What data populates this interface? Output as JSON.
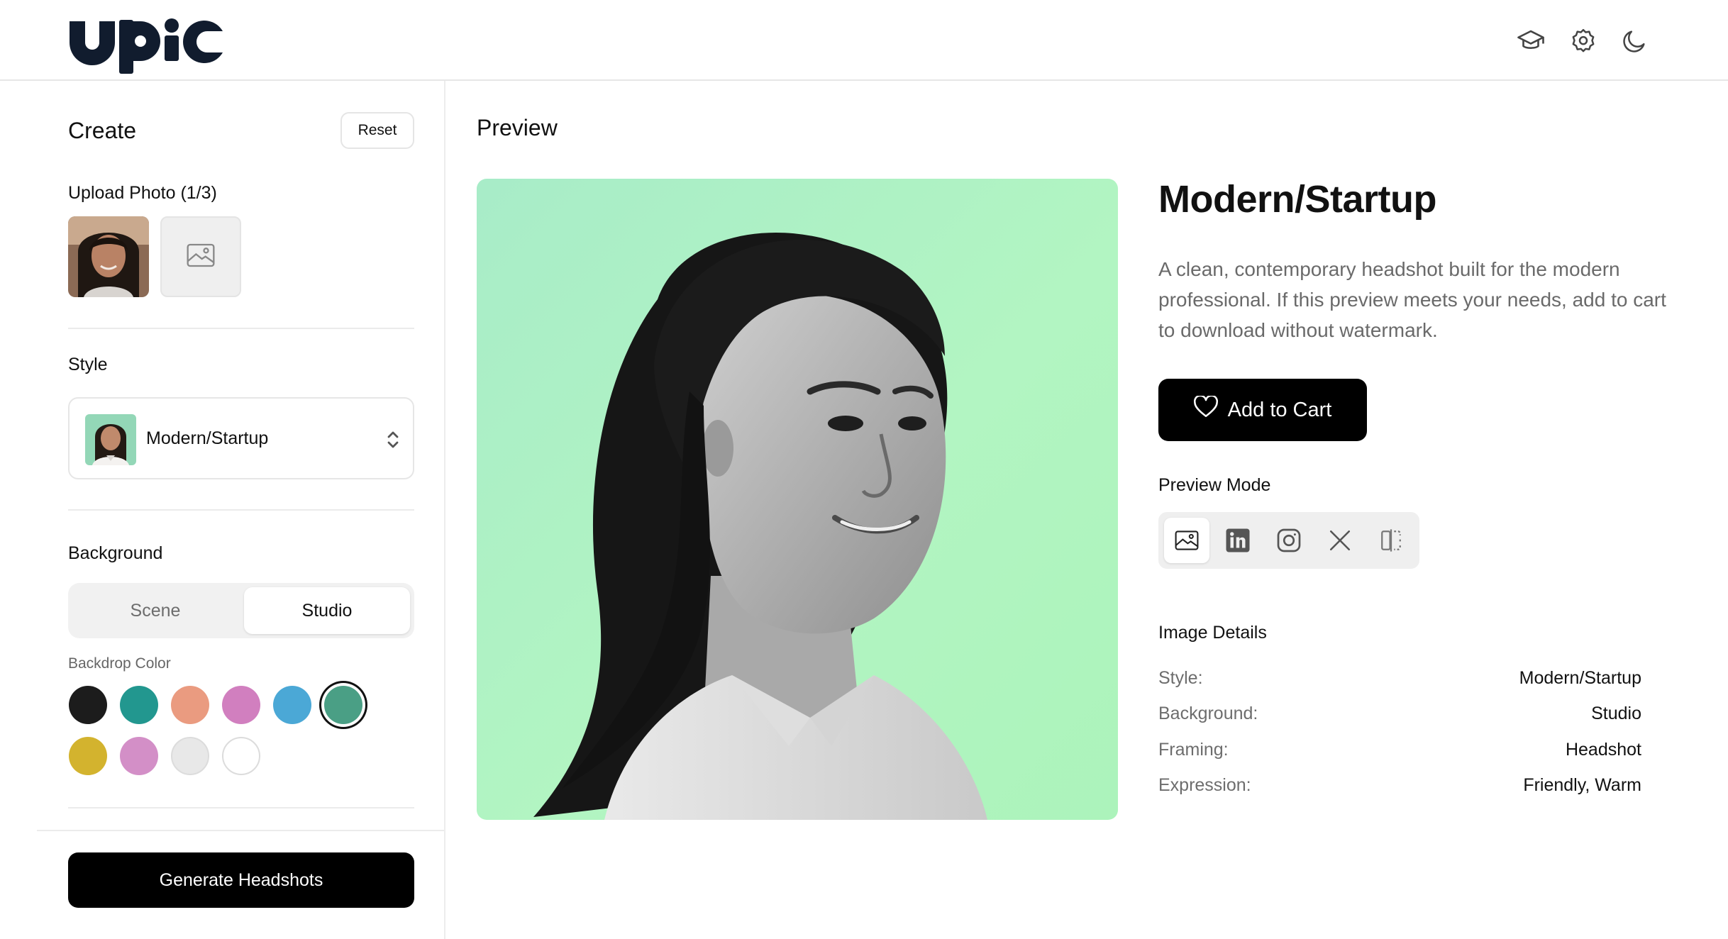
{
  "header": {
    "logo_text": "upic",
    "icons": [
      "graduation-cap-icon",
      "settings-gear-icon",
      "moon-icon"
    ]
  },
  "sidebar": {
    "title": "Create",
    "reset_label": "Reset",
    "upload": {
      "label": "Upload Photo (1/3)"
    },
    "style": {
      "label": "Style",
      "selected": "Modern/Startup"
    },
    "background": {
      "label": "Background",
      "options": [
        "Scene",
        "Studio"
      ],
      "selected": "Studio",
      "backdrop_label": "Backdrop Color",
      "colors": [
        "#1c1c1c",
        "#22978f",
        "#ea9b80",
        "#d17fbf",
        "#4ba8d6",
        "#4a9f85",
        "#d3b32e",
        "#d38fc7",
        "#e8e8e8",
        "#ffffff"
      ],
      "selected_color": "#4a9f85"
    },
    "generate_label": "Generate Headshots"
  },
  "main": {
    "preview_title": "Preview",
    "style_heading": "Modern/Startup",
    "description": "A clean, contemporary headshot built for the modern professional. If this preview meets your needs, add to cart to download without watermark.",
    "add_to_cart_label": "Add to Cart",
    "preview_mode": {
      "label": "Preview Mode",
      "modes": [
        "image-icon",
        "linkedin-icon",
        "instagram-icon",
        "x-icon",
        "compare-icon"
      ],
      "active": "image-icon"
    },
    "details": {
      "title": "Image Details",
      "rows": [
        {
          "key": "Style:",
          "value": "Modern/Startup"
        },
        {
          "key": "Background:",
          "value": "Studio"
        },
        {
          "key": "Framing:",
          "value": "Headshot"
        },
        {
          "key": "Expression:",
          "value": "Friendly, Warm"
        }
      ]
    }
  },
  "colors": {
    "accent": "#000000",
    "preview_bg": "#aef0c4"
  }
}
